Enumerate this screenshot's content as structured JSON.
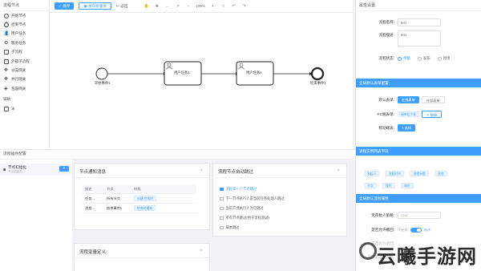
{
  "palette": {
    "title": "流程节点",
    "items": [
      {
        "label": "开始节点",
        "icon": "start-event-icon"
      },
      {
        "label": "结束节点",
        "icon": "end-event-icon"
      },
      {
        "label": "用户任务",
        "icon": "user-task-icon"
      },
      {
        "label": "服务任务",
        "icon": "service-task-icon"
      },
      {
        "label": "子流程",
        "icon": "subprocess-icon"
      },
      {
        "label": "外部子流程",
        "icon": "call-activity-icon"
      },
      {
        "label": "分支网关",
        "icon": "exclusive-gateway-icon"
      },
      {
        "label": "并行网关",
        "icon": "parallel-gateway-icon"
      },
      {
        "label": "包容网关",
        "icon": "inclusive-gateway-icon"
      }
    ],
    "aux_title": "辅助",
    "aux_items": [
      {
        "label": "泳",
        "icon": "pool-icon"
      }
    ]
  },
  "toolbar": {
    "save": "保存",
    "save_draft": "发布新版本",
    "back": "返回",
    "zoom": "100%"
  },
  "canvas": {
    "start_label": "开始事件1",
    "task1": "用户任务1",
    "task2": "用户任务2",
    "end_label": "结束事件1"
  },
  "right_panel": {
    "title": "属性设置",
    "name_label": "流程名称:",
    "name_value": "test",
    "desc_label": "流程描述:",
    "desc_value": "test",
    "status_label": "流程状态:",
    "status_options": [
      "草稿",
      "发布",
      "停用"
    ],
    "sec1": "全局默认表单配置",
    "default_form_label": "默认表单:",
    "form_btn_online": "在线表单",
    "form_btn_external": "外部表单",
    "pc_form_label": "PC端表单:",
    "pc_form_value": "请单位子表",
    "pc_form_btn": "编辑",
    "mobile_label": "移动端表:",
    "mobile_btn": "选择",
    "sec2": "流程实例列表字段",
    "tags": [
      "发起人",
      "发起时间",
      "流程标题",
      "状态",
      "节点",
      "操作",
      "耗时"
    ],
    "sec3": "全局默认流程属性",
    "no_handler_label": "无审批人策略:",
    "no_handler_placeholder": "自动",
    "allow_withdraw_label": "是否允许撤回:",
    "allow_withdraw_off": "不允许",
    "allow_withdraw_on": "允许",
    "row_a_label": "是否允许退回:",
    "row_b_label": "是否必须填意见:"
  },
  "bottom": {
    "title": "流程插件配置",
    "list_item": "节点初始化",
    "list_item_sub": "节点初始化",
    "add": "+",
    "card1_title": "节点通知消息",
    "card1_cols": [
      "描述",
      "节点",
      "时机"
    ],
    "card1_rows": [
      [
        "任务...",
        "所有节点",
        "创建/完成时"
      ],
      [
        "流程...",
        "结束事件1",
        "结束时通知"
      ]
    ],
    "card2_title": "流程节点自动跳过",
    "card2_items": [
      "流程第一个节点跳过",
      "下一节点执行人是当前任务处理人跳过",
      "当前节点执行人为空跳过",
      "所有节点跳过(用于流程测试)",
      "脚本跳过"
    ],
    "card3_title": "流程变量定义",
    "close": "×"
  },
  "watermark": "云曦手游网"
}
